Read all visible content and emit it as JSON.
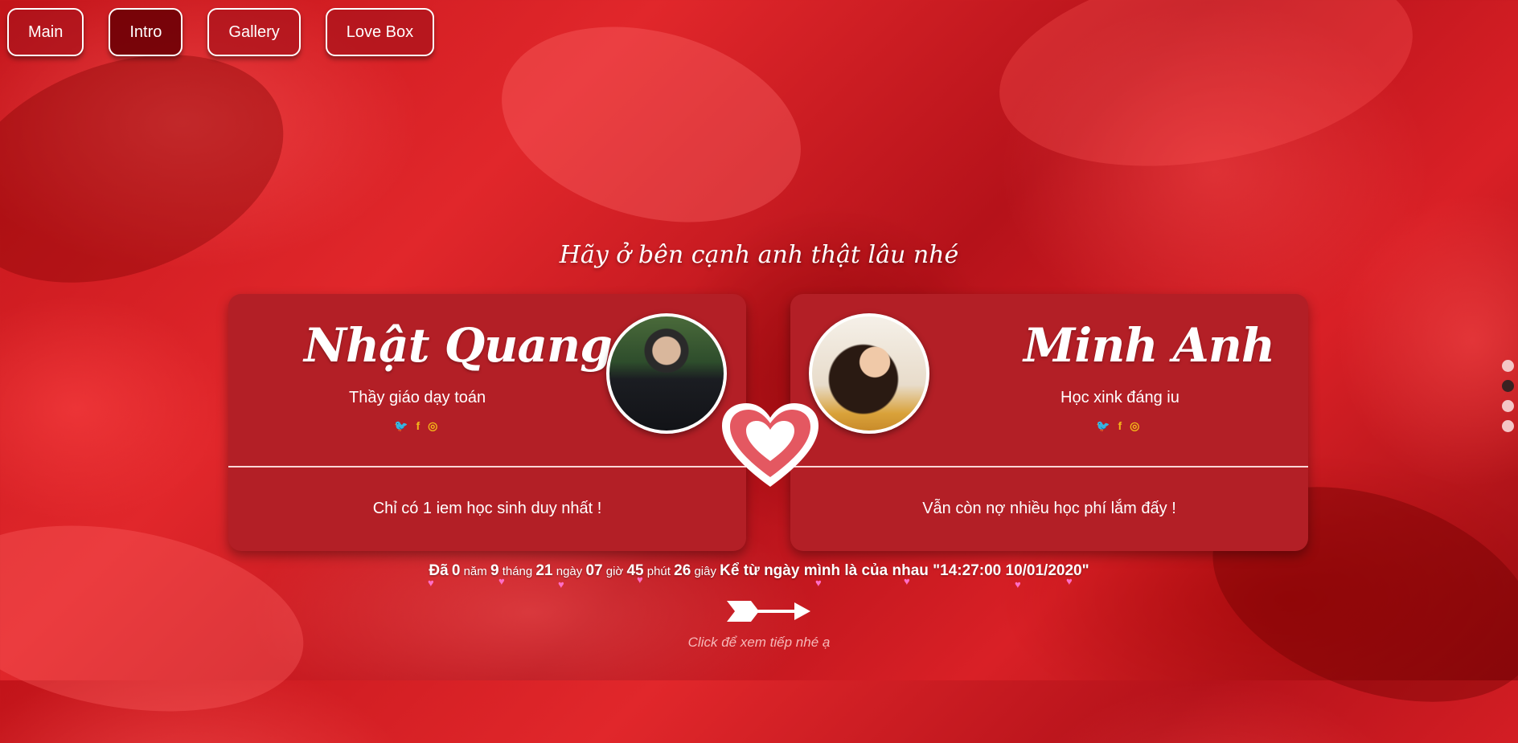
{
  "nav": {
    "items": [
      {
        "label": "Main"
      },
      {
        "label": "Intro"
      },
      {
        "label": "Gallery"
      },
      {
        "label": "Love Box"
      }
    ]
  },
  "headline": "Hãy ở bên cạnh anh thật lâu nhé",
  "cards": {
    "left": {
      "name": "Nhật Quang",
      "role": "Thầy giáo dạy toán",
      "message": "Chỉ có 1 iem học sinh duy nhất !"
    },
    "right": {
      "name": "Minh Anh",
      "role": "Học xink đáng iu",
      "message": "Vẫn còn nợ nhiều học phí lắm đấy !"
    },
    "socials": [
      "twitter-icon",
      "facebook-icon",
      "instagram-icon"
    ]
  },
  "counter": {
    "prefix": "Đã",
    "years": "0",
    "years_label": "năm",
    "months": "9",
    "months_label": "tháng",
    "days": "21",
    "days_label": "ngày",
    "hours": "07",
    "hours_label": "giờ",
    "minutes": "45",
    "minutes_label": "phút",
    "seconds": "26",
    "seconds_label": "giây",
    "since": "Kể từ ngày mình là của nhau \"14:27:00 10/01/2020\""
  },
  "hint": "Click để xem tiếp nhé ạ",
  "colors": {
    "accent": "#b31f26",
    "social": "#f3b61a",
    "background": "#d22027"
  }
}
